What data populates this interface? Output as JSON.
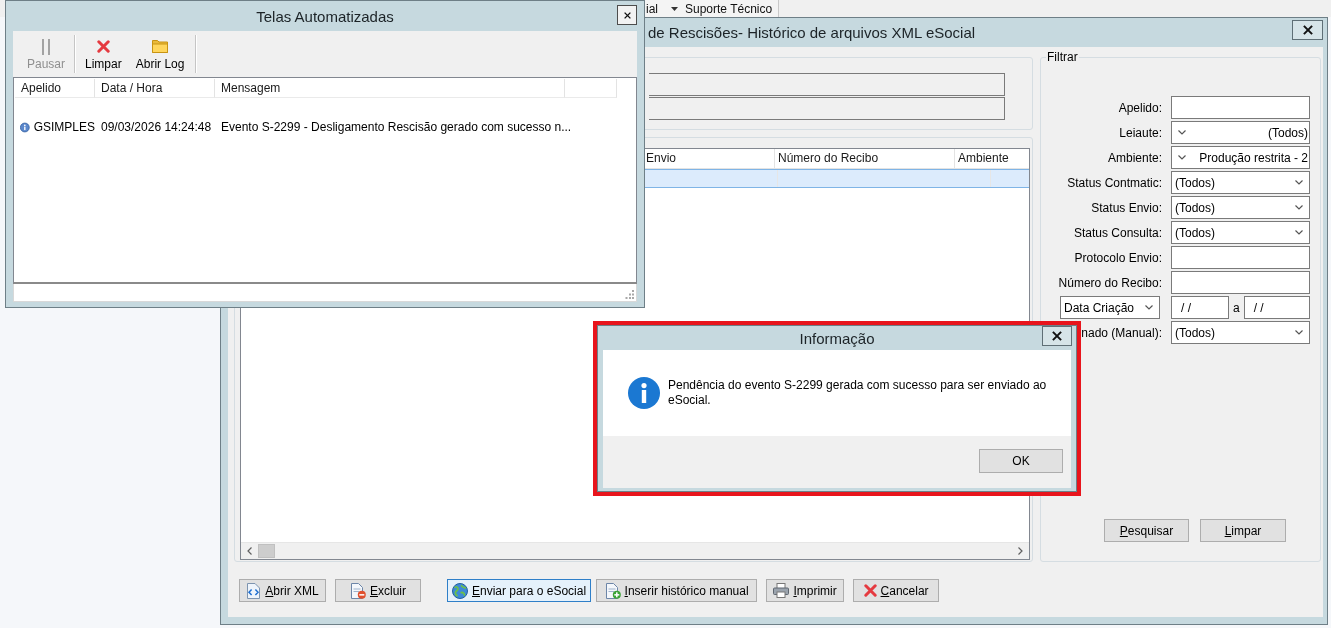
{
  "background_app": {
    "toolbar": [
      {
        "kind": "menu",
        "label": "ial"
      },
      {
        "kind": "button",
        "label": "Suporte Técnico"
      }
    ]
  },
  "automation_window": {
    "title": "Telas Automatizadas",
    "toolbar": [
      {
        "label": "Pausar",
        "disabled": true
      },
      {
        "label": "Limpar",
        "disabled": false
      },
      {
        "label": "Abrir Log",
        "disabled": false
      }
    ],
    "log": {
      "columns": [
        "Apelido",
        "Data / Hora",
        "Mensagem"
      ],
      "rows": [
        {
          "apelido": "GSIMPLES",
          "data_hora": "09/03/2026 14:24:48",
          "mensagem": "Evento S-2299 - Desligamento Rescisão gerado com sucesso n..."
        }
      ]
    }
  },
  "main_window": {
    "title": "de Rescisões- Histórico de arquivos XML eSocial",
    "table": {
      "columns": [
        "Envio",
        "Número do Recibo",
        "Ambiente"
      ],
      "rows": [
        {
          "selected": true
        }
      ]
    },
    "filter": {
      "title": "Filtrar",
      "fields": [
        {
          "kind": "text",
          "label": "Apelido:"
        },
        {
          "kind": "mirrored",
          "label": "Leiaute:",
          "value": "(Todos)"
        },
        {
          "kind": "mirrored",
          "label": "Ambiente:",
          "value": "Produção restrita - 2"
        },
        {
          "kind": "dropdown",
          "label": "Status Contmatic:",
          "value": "(Todos)"
        },
        {
          "kind": "dropdown",
          "label": "Status Envio:",
          "value": "(Todos)"
        },
        {
          "kind": "dropdown",
          "label": "Status Consulta:",
          "value": "(Todos)"
        },
        {
          "kind": "text",
          "label": "Protocolo Envio:"
        },
        {
          "kind": "text",
          "label": "Número do Recibo:"
        },
        {
          "kind": "daterange",
          "selector": "Data Criação",
          "from": "/ /",
          "separator": "a",
          "to": "/ /"
        },
        {
          "kind": "dropdown",
          "label": "nado (Manual):",
          "value": "(Todos)"
        }
      ],
      "buttons": [
        "Pesquisar",
        "Limpar"
      ]
    },
    "buttons": [
      {
        "label": "Abrir XML",
        "focused": false
      },
      {
        "label": "Excluir",
        "focused": false
      },
      {
        "label": "Enviar para o eSocial",
        "focused": true
      },
      {
        "label": "Inserir histórico manual",
        "focused": false
      },
      {
        "label": "Imprimir",
        "focused": false
      },
      {
        "label": "Cancelar",
        "focused": false
      }
    ]
  },
  "info_dialog": {
    "title": "Informação",
    "message": "Pendência do evento S-2299 gerada com sucesso para ser enviado ao eSocial.",
    "buttons": [
      "OK"
    ],
    "highlighted": true
  }
}
